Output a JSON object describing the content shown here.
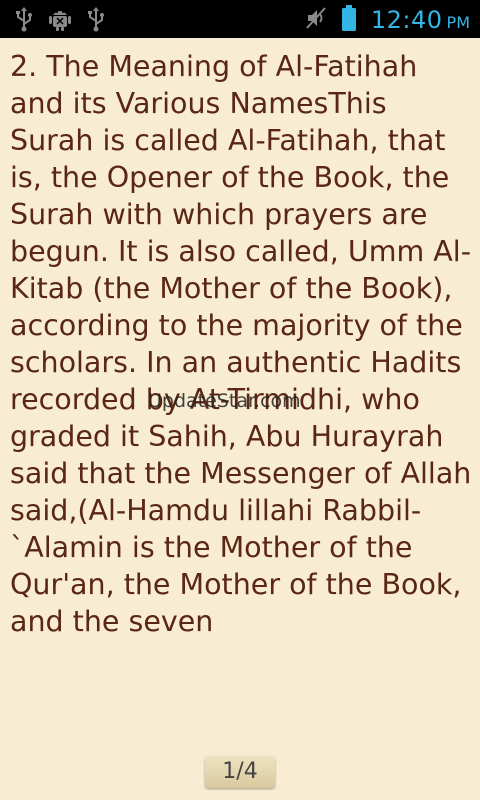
{
  "status_bar": {
    "time": "12:40",
    "ampm": "PM",
    "icons": [
      "usb-icon",
      "android-debug-icon",
      "usb-icon",
      "mute-icon",
      "battery-icon"
    ],
    "accent_color": "#33B5E5"
  },
  "content": {
    "text": "2. The Meaning of Al-Fatihah and its Various NamesThis Surah is called Al-Fatihah, that is, the Opener of the Book, the Surah with which prayers are begun. It is also called, Umm Al-Kitab (the Mother of the Book), according to the majority of the scholars. In an authentic Hadits recorded by At-Tirmidhi, who graded it Sahih, Abu Hurayrah said that the Messenger of Allah said,(Al-Hamdu lillahi Rabbil-`Alamin is the Mother of the Qur'an, the Mother of the Book, and the seven",
    "text_color": "#5A2615",
    "background_color": "#F8EDD3"
  },
  "overlay": {
    "watermark": "UpdateStar.com"
  },
  "pager": {
    "label": "1/4"
  }
}
